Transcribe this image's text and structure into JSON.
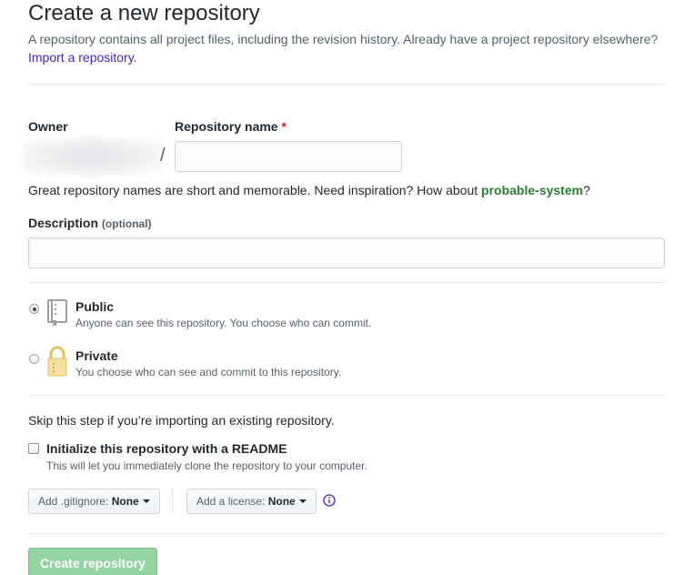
{
  "header": {
    "title": "Create a new repository",
    "subtitle": "A repository contains all project files, including the revision history. Already have a project repository elsewhere?",
    "import_link": "Import a repository."
  },
  "owner": {
    "label": "Owner",
    "value": "",
    "separator": "/"
  },
  "repo_name": {
    "label": "Repository name",
    "required_mark": "*",
    "value": "",
    "hint_prefix": "Great repository names are short and memorable. Need inspiration? How about ",
    "suggestion": "probable-system",
    "hint_suffix": "?"
  },
  "description": {
    "label": "Description",
    "optional": "(optional)",
    "value": ""
  },
  "visibility": {
    "selected": "public",
    "options": [
      {
        "id": "public",
        "title": "Public",
        "desc": "Anyone can see this repository. You choose who can commit.",
        "icon": "repo-book-icon"
      },
      {
        "id": "private",
        "title": "Private",
        "desc": "You choose who can see and commit to this repository.",
        "icon": "lock-icon"
      }
    ]
  },
  "init": {
    "skip_text": "Skip this step if you’re importing an existing repository.",
    "readme_label": "Initialize this repository with a README",
    "readme_desc": "This will let you immediately clone the repository to your computer.",
    "readme_checked": false
  },
  "gitignore": {
    "prefix": "Add .gitignore:",
    "value": "None"
  },
  "license": {
    "prefix": "Add a license:",
    "value": "None"
  },
  "info_icon": "info-icon",
  "submit": {
    "label": "Create repository",
    "disabled": true
  },
  "colors": {
    "link": "#4a24b8",
    "suggestion": "#2b7d30",
    "required": "#cb2431",
    "create_button_bg": "#94d3a2",
    "info_icon": "#6f42c1"
  }
}
